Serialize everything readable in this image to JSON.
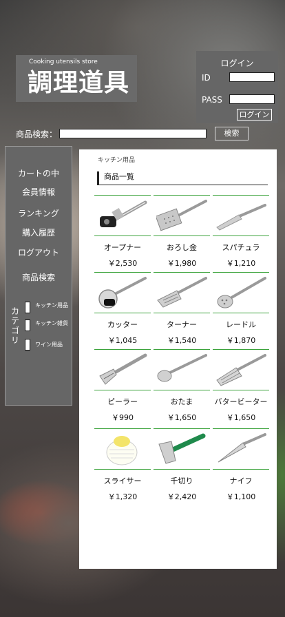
{
  "logo": {
    "subtitle": "Cooking utensils store",
    "title": "調理道具"
  },
  "login": {
    "title": "ログイン",
    "id_label": "ID",
    "pass_label": "PASS",
    "button_label": "ログイン"
  },
  "search": {
    "label": "商品検索：",
    "button_label": "検索"
  },
  "sidebar": {
    "items": [
      {
        "label": "カートの中"
      },
      {
        "label": "会員情報"
      },
      {
        "label": "ランキング"
      },
      {
        "label": "購入履歴"
      },
      {
        "label": "ログアウト"
      },
      {
        "label": "商品検索"
      }
    ],
    "category_label": "カテゴリ",
    "categories": [
      {
        "label": "キッチン用品"
      },
      {
        "label": "キッチン雑貨"
      },
      {
        "label": "ワイン用品"
      }
    ]
  },
  "main": {
    "breadcrumb": "キッチン用品",
    "section_title": "商品一覧",
    "products": [
      {
        "name": "オープナー",
        "price": "￥2,530"
      },
      {
        "name": "おろし金",
        "price": "￥1,980"
      },
      {
        "name": "スパチュラ",
        "price": "￥1,210"
      },
      {
        "name": "カッター",
        "price": "￥1,045"
      },
      {
        "name": "ターナー",
        "price": "￥1,540"
      },
      {
        "name": "レードル",
        "price": "￥1,870"
      },
      {
        "name": "ピーラー",
        "price": "￥990"
      },
      {
        "name": "おたま",
        "price": "￥1,650"
      },
      {
        "name": "バタービーター",
        "price": "￥1,650"
      },
      {
        "name": "スライサー",
        "price": "￥1,320"
      },
      {
        "name": "千切り",
        "price": "￥2,420"
      },
      {
        "name": "ナイフ",
        "price": "￥1,100"
      }
    ]
  }
}
